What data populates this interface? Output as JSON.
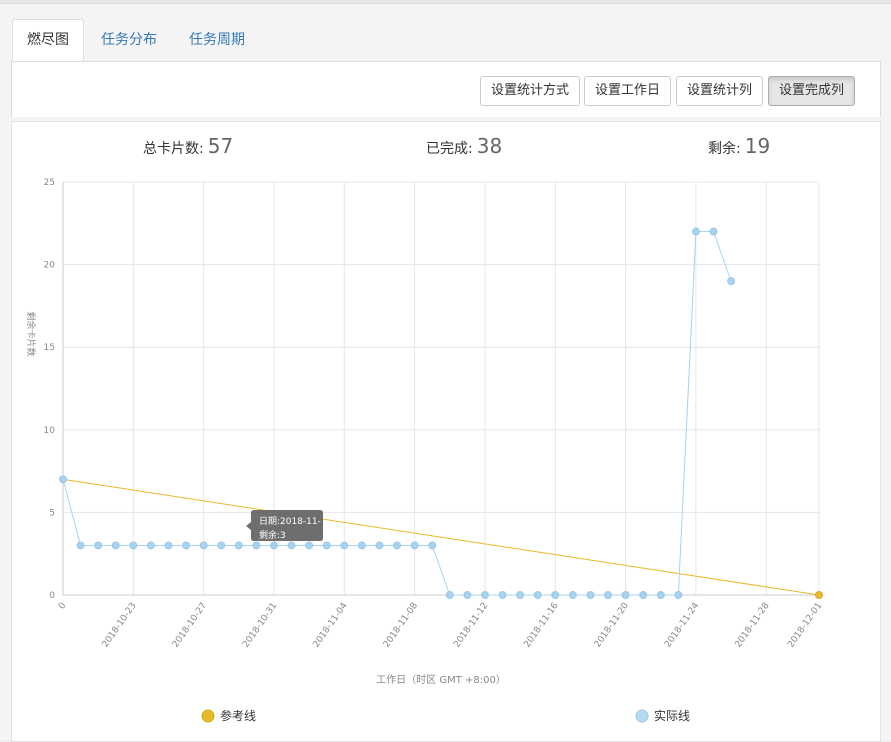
{
  "tabs": [
    {
      "label": "燃尽图",
      "active": true
    },
    {
      "label": "任务分布",
      "active": false
    },
    {
      "label": "任务周期",
      "active": false
    }
  ],
  "toolbar": {
    "btn_stat_method": "设置统计方式",
    "btn_workday": "设置工作日",
    "btn_stat_column": "设置统计列",
    "btn_done_column": "设置完成列",
    "active_button": "设置完成列"
  },
  "stats": {
    "total_label": "总卡片数:",
    "total_value": "57",
    "done_label": "已完成:",
    "done_value": "38",
    "remain_label": "剩余:",
    "remain_value": "19"
  },
  "tooltip": {
    "line1": "日期:2018-11-",
    "line2": "剩余:3"
  },
  "colors": {
    "reference": "#e8b92b",
    "actual": "#a8d2ee",
    "actual_point": "#a8d2ee",
    "grid": "#e6e6e6",
    "tooltip_bg": "#666666"
  },
  "chart_data": {
    "type": "line",
    "xlabel": "工作日（时区 GMT +8:00）",
    "ylabel": "剩余卡片数",
    "ylim": [
      0,
      25
    ],
    "yticks": [
      0,
      5,
      10,
      15,
      20,
      25
    ],
    "x_start": "2018-10-19",
    "x_end": "2018-12-01",
    "xtick_labels": [
      "0",
      "2018-10-23",
      "2018-10-27",
      "2018-10-31",
      "2018-11-04",
      "2018-11-08",
      "2018-11-12",
      "2018-11-16",
      "2018-11-20",
      "2018-11-24",
      "2018-11-28",
      "2018-12-01"
    ],
    "legend_position": "bottom",
    "series": [
      {
        "name": "参考线",
        "dates": [
          "2018-10-19",
          "2018-12-01"
        ],
        "values": [
          7,
          0
        ]
      },
      {
        "name": "实际线",
        "dates": [
          "2018-10-19",
          "2018-10-20",
          "2018-10-21",
          "2018-10-22",
          "2018-10-23",
          "2018-10-24",
          "2018-10-25",
          "2018-10-26",
          "2018-10-27",
          "2018-10-28",
          "2018-10-29",
          "2018-10-30",
          "2018-10-31",
          "2018-11-01",
          "2018-11-02",
          "2018-11-03",
          "2018-11-04",
          "2018-11-05",
          "2018-11-06",
          "2018-11-07",
          "2018-11-08",
          "2018-11-09",
          "2018-11-10",
          "2018-11-11",
          "2018-11-12",
          "2018-11-13",
          "2018-11-14",
          "2018-11-15",
          "2018-11-16",
          "2018-11-17",
          "2018-11-18",
          "2018-11-19",
          "2018-11-20",
          "2018-11-21",
          "2018-11-22",
          "2018-11-23",
          "2018-11-24",
          "2018-11-25",
          "2018-11-26"
        ],
        "values": [
          7,
          3,
          3,
          3,
          3,
          3,
          3,
          3,
          3,
          3,
          3,
          3,
          3,
          3,
          3,
          3,
          3,
          3,
          3,
          3,
          3,
          3,
          0,
          0,
          0,
          0,
          0,
          0,
          0,
          0,
          0,
          0,
          0,
          0,
          0,
          0,
          22,
          22,
          19
        ]
      }
    ]
  }
}
